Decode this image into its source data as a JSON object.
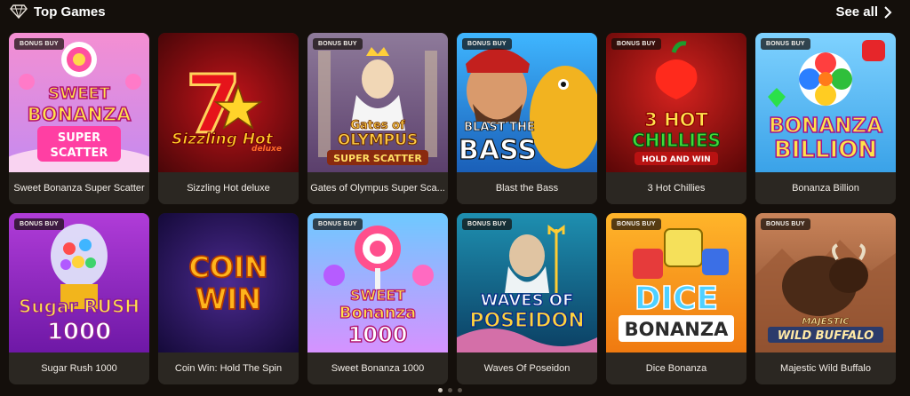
{
  "header": {
    "title": "Top Games",
    "see_all": "See all",
    "icon": "diamond-icon"
  },
  "badge_label": "BONUS BUY",
  "games": [
    {
      "name": "Sweet Bonanza Super Scatter",
      "bonus_buy": true,
      "art": [
        "SWEET",
        "BONANZA",
        "SUPER",
        "SCATTER"
      ]
    },
    {
      "name": "Sizzling Hot deluxe",
      "bonus_buy": false,
      "art": [
        "7",
        "Sizzling Hot",
        "deluxe"
      ]
    },
    {
      "name": "Gates of Olympus Super Sca...",
      "bonus_buy": true,
      "art": [
        "Gates of",
        "OLYMPUS",
        "SUPER SCATTER"
      ]
    },
    {
      "name": "Blast the Bass",
      "bonus_buy": true,
      "art": [
        "BLAST THE",
        "BASS"
      ]
    },
    {
      "name": "3 Hot Chillies",
      "bonus_buy": true,
      "art": [
        "3 HOT",
        "CHILLIES",
        "HOLD AND WIN"
      ]
    },
    {
      "name": "Bonanza Billion",
      "bonus_buy": true,
      "art": [
        "BONANZA",
        "BILLION"
      ]
    },
    {
      "name": "Sugar Rush 1000",
      "bonus_buy": true,
      "art": [
        "Sugar RUSH",
        "1000"
      ]
    },
    {
      "name": "Coin Win: Hold The Spin",
      "bonus_buy": false,
      "art": [
        "COIN",
        "WIN"
      ]
    },
    {
      "name": "Sweet Bonanza 1000",
      "bonus_buy": true,
      "art": [
        "SWEET",
        "Bonanza",
        "1000"
      ]
    },
    {
      "name": "Waves Of Poseidon",
      "bonus_buy": true,
      "art": [
        "WAVES OF",
        "POSEIDON"
      ]
    },
    {
      "name": "Dice Bonanza",
      "bonus_buy": true,
      "art": [
        "DICE",
        "BONANZA"
      ]
    },
    {
      "name": "Majestic Wild Buffalo",
      "bonus_buy": true,
      "art": [
        "MAJESTIC",
        "WILD BUFFALO"
      ]
    }
  ],
  "pagination": {
    "pages": 3,
    "current": 1
  },
  "colors": {
    "background": "#140f0b",
    "caption_bg": "#2b2722",
    "text": "#ffffff"
  }
}
